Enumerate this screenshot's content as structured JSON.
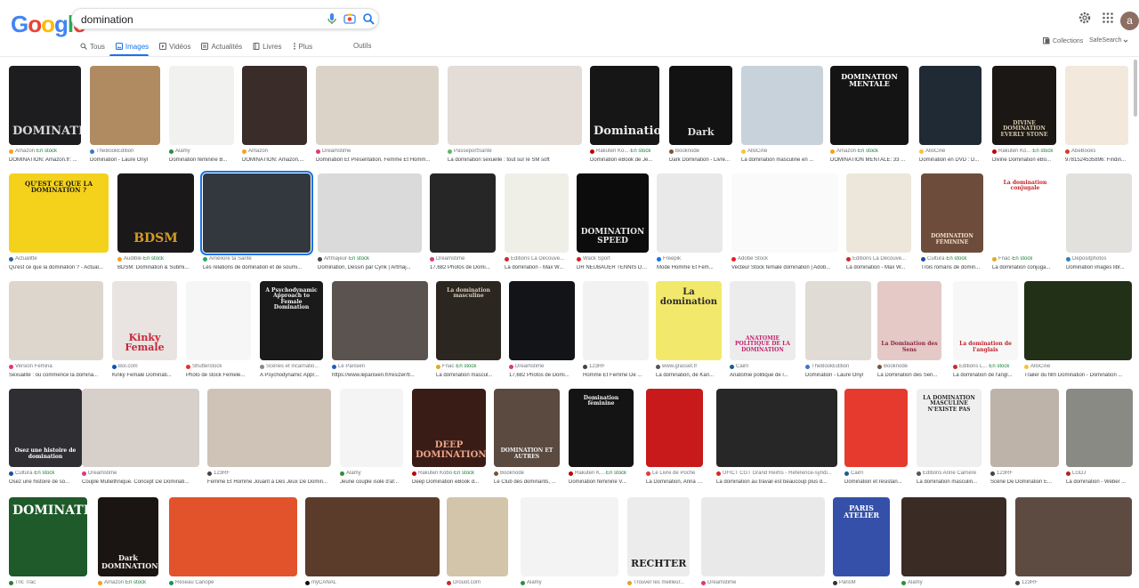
{
  "header": {
    "logo": "Google",
    "query": "domination",
    "colors": {
      "blue": "#4285f4",
      "red": "#ea4335",
      "yellow": "#fbbc05",
      "green": "#34a853",
      "accent": "#1a73e8"
    },
    "avatar_letter": "a",
    "icons": [
      "microphone-icon",
      "camera-icon",
      "search-icon",
      "gear-icon",
      "apps-grid-icon"
    ]
  },
  "tabs": [
    {
      "label": "Tous",
      "icon": "search-icon"
    },
    {
      "label": "Images",
      "icon": "image-icon"
    },
    {
      "label": "Vidéos",
      "icon": "play-icon"
    },
    {
      "label": "Actualités",
      "icon": "news-icon"
    },
    {
      "label": "Livres",
      "icon": "book-icon"
    },
    {
      "label": "Plus",
      "icon": "more-vert-icon"
    }
  ],
  "tools_label": "Outils",
  "collections_label": "Collections",
  "safesearch_label": "SafeSearch",
  "results": [
    [
      {
        "source": "Amazon",
        "stock": "En stock",
        "title": "DOMINATION: Amazon.fr: ...",
        "fav": "#f7a21b",
        "bg": "#1d1d20",
        "text": "DOMINATION",
        "text_color": "#d7d7d7"
      },
      {
        "source": "TheBookEdition",
        "title": "Domination - Laure Onyl",
        "fav": "#3b78c2",
        "bg": "#b08b62"
      },
      {
        "source": "Alamy",
        "title": "Domination féminine B...",
        "fav": "#2f8d3e",
        "bg": "#f1f1ef"
      },
      {
        "source": "Amazon",
        "title": "DOMINATION: Amazon....",
        "fav": "#f7a21b",
        "bg": "#3a2c29"
      },
      {
        "source": "Dreamstime",
        "title": "Domination Et Présentation. Femme Et Homm...",
        "fav": "#d93a7a",
        "bg": "#dcd3c8"
      },
      {
        "source": "PasseportSanté",
        "title": "La domination sexuelle : tout sur le SM soft",
        "fav": "#62b56a",
        "bg": "#e3dcd7"
      },
      {
        "source": "Rakuten Ko...",
        "stock": "En stock",
        "title": "Domination eBook de Je...",
        "fav": "#bf0000",
        "bg": "#161616",
        "text": "Domination",
        "text_color": "#e9e9e9"
      },
      {
        "source": "Booknode",
        "title": "Dark Domination - Livre...",
        "fav": "#7a5539",
        "bg": "#121212",
        "text": "Dark",
        "text_color": "#ddd"
      },
      {
        "source": "AlloCiné",
        "title": "La domination masculine en ...",
        "fav": "#f6c33a",
        "bg": "#c8d2da"
      },
      {
        "source": "Amazon",
        "stock": "En stock",
        "title": "DOMINATION MENTALE: 33 ...",
        "fav": "#f7a21b",
        "bg": "#141414",
        "text": "DOMINATION MENTALE",
        "text_color": "#fff",
        "text_top": true
      },
      {
        "source": "AlloCiné",
        "title": "Domination en DVD : D...",
        "fav": "#f6c33a",
        "bg": "#202a35"
      },
      {
        "source": "Rakuten Ko...",
        "stock": "En stock",
        "title": "Divine Domination eBo...",
        "fav": "#bf0000",
        "bg": "#1a1714",
        "text": "DIVINE DOMINATION EVERLY STONE",
        "text_color": "#d7c8a8"
      },
      {
        "source": "AbeBooks",
        "title": "9781524535896: Findin...",
        "fav": "#d43d2a",
        "bg": "#f2e9dc"
      }
    ],
    [
      {
        "source": "Actualitte",
        "title": "Qu'est ce que la domination ? - Actual...",
        "fav": "#305f9c",
        "bg": "#f4d21c",
        "text": "QU'EST CE QUE LA DOMINATION ?",
        "text_color": "#1d1d1d",
        "text_top": true
      },
      {
        "source": "Audible",
        "stock": "En stock",
        "title": "BDSM: Domination & Submi...",
        "fav": "#f79c1c",
        "bg": "#1a1818",
        "text": "BDSM",
        "text_color": "#d49c28"
      },
      {
        "source": "Améliore ta Santé",
        "title": "Les relations de domination et de soumi...",
        "fav": "#2da562",
        "bg": "#33383f",
        "selected": true
      },
      {
        "source": "Artmajeur",
        "stock": "En stock",
        "title": "Domination, Dessin par Cyrik | Artmaj...",
        "fav": "#444444",
        "bg": "#dadada"
      },
      {
        "source": "Dreamstime",
        "title": "17,682 Photos de Domi...",
        "fav": "#d93a7a",
        "bg": "#262626"
      },
      {
        "source": "Éditions La Découve...",
        "title": "La domination - Max W...",
        "fav": "#c92c2c",
        "bg": "#efefe7"
      },
      {
        "source": "Wack Sport",
        "title": "DR NEUBAUER TENNIS DE...",
        "fav": "#d82121",
        "bg": "#0c0c0c",
        "text": "DOMINATION SPEED",
        "text_color": "#e6e6e6"
      },
      {
        "source": "Freepik",
        "title": "Mode Homme Et Fem...",
        "fav": "#1273eb",
        "bg": "#e9e9e9"
      },
      {
        "source": "Adobe Stock",
        "title": "Vecteur Stock female domination | Adob...",
        "fav": "#ef1c24",
        "bg": "#fafafa"
      },
      {
        "source": "Éditions La Découve...",
        "title": "La domination - Max W...",
        "fav": "#c92c2c",
        "bg": "#ede7db"
      },
      {
        "source": "Cultura",
        "stock": "En stock",
        "title": "Trois romans de domin...",
        "fav": "#1b4e9b",
        "bg": "#6e4c3b",
        "text": "DOMINATION FÉMININE",
        "text_color": "#f0e1c8"
      },
      {
        "source": "Fnac",
        "stock": "En stock",
        "title": "La domination conjuga...",
        "fav": "#e1a925",
        "bg": "#ffffff",
        "text": "La domination conjugale",
        "text_color": "#c4232a",
        "text_top": true
      },
      {
        "source": "Depositphotos",
        "title": "Domination images libr...",
        "fav": "#2c7fc2",
        "bg": "#e3e1dd"
      }
    ],
    [
      {
        "source": "Version Femina",
        "title": "Sexualité : où commence la domina...",
        "fav": "#e8356d",
        "bg": "#ddd6cd"
      },
      {
        "source": "Bol.com",
        "title": "Kinky Female Dominati...",
        "fav": "#0a55b7",
        "bg": "#e9e3e1",
        "text": "Kinky Female",
        "text_color": "#c6283a"
      },
      {
        "source": "Shutterstock",
        "title": "Photo de stock Femele...",
        "fav": "#ec2e2f",
        "bg": "#f6f6f6"
      },
      {
        "source": "Scènes et incarnatio...",
        "title": "A Psychodynamic Appr...",
        "fav": "#888888",
        "bg": "#1a1a1a",
        "text": "A Psychodynamic Approach to Female Domination",
        "text_color": "#f2f2f2",
        "text_top": true
      },
      {
        "source": "Le Parisien",
        "title": "https://www.leparisien.fr/resizer/tl...",
        "fav": "#1c5fc7",
        "bg": "#5a5350"
      },
      {
        "source": "Fnac",
        "stock": "En stock",
        "title": "La domination mascul...",
        "fav": "#e1a925",
        "bg": "#2c2621",
        "text": "La domination masculine",
        "text_color": "#d8ccb8",
        "text_top": true
      },
      {
        "source": "Dreamstime",
        "title": "17,682 Photos de Domi...",
        "fav": "#d93a7a",
        "bg": "#121418"
      },
      {
        "source": "123RF",
        "title": "Homme Et Femme De ...",
        "fav": "#444444",
        "bg": "#f2f2f2"
      },
      {
        "source": "www.grasset.fr",
        "title": "La domination, de Kari...",
        "fav": "#555555",
        "bg": "#f2e96c",
        "text": "La domination",
        "text_color": "#2a2a2a",
        "text_top": true
      },
      {
        "source": "Cairn",
        "title": "Anatomie politique de l...",
        "fav": "#1a5c8f",
        "bg": "#ececec",
        "text": "ANATOMIE POLITIQUE DE LA DOMINATION",
        "text_color": "#c3206c"
      },
      {
        "source": "TheBookEdition",
        "title": "Domination - Laure Onyl",
        "fav": "#3b78c2",
        "bg": "#e0dbd4"
      },
      {
        "source": "Booknode",
        "title": "La Domination des Sen...",
        "fav": "#7a5539",
        "bg": "#e4c9c6",
        "text": "La Domination des Sens",
        "text_color": "#8d2440"
      },
      {
        "source": "Éditions L...",
        "stock": "En stock",
        "title": "La domination de l'angl...",
        "fav": "#c92c2c",
        "bg": "#f7f7f7",
        "text": "La domination de l'anglais",
        "text_color": "#c0202a"
      },
      {
        "source": "AlloCiné",
        "title": "Trailer du film Domination - Domination ...",
        "fav": "#f6c33a",
        "bg": "#233018"
      }
    ],
    [
      {
        "source": "Cultura",
        "stock": "En stock",
        "title": "Osez une histoire de so...",
        "fav": "#1b4e9b",
        "bg": "#2f2f33",
        "text": "Osez une histoire de domination",
        "text_color": "#ffffff"
      },
      {
        "source": "Dreamstime",
        "title": "Couple Mutiethnique. Concept De Dominati...",
        "fav": "#d93a7a",
        "bg": "#d7cfc9"
      },
      {
        "source": "123RF",
        "title": "Femme Et Homme Jouant à Des Jeux De Domin...",
        "fav": "#444444",
        "bg": "#cfc2b7"
      },
      {
        "source": "Alamy",
        "title": "Jeune couple isolé d'af...",
        "fav": "#2f8d3e",
        "bg": "#f4f4f4"
      },
      {
        "source": "Rakuten Kobo",
        "stock": "En stock",
        "title": "Deep Domination eBook d...",
        "fav": "#bf0000",
        "bg": "#3a1c17",
        "text": "DEEP DOMINATION",
        "text_color": "#e8a689"
      },
      {
        "source": "Booknode",
        "title": "Le Club des dominants, ...",
        "fav": "#7a5539",
        "bg": "#5a4a40",
        "text": "DOMINATION ET AUTRES",
        "text_color": "#f4f4f4"
      },
      {
        "source": "Rakuten K...",
        "stock": "En stock",
        "title": "Domination féminine V...",
        "fav": "#bf0000",
        "bg": "#141414",
        "text": "Domination féminine",
        "text_color": "#f0f0f0",
        "text_top": true
      },
      {
        "source": "Le Livre de Poche",
        "title": "La Domination, Anna d...",
        "fav": "#e23a3a",
        "bg": "#c81a1a"
      },
      {
        "source": "UFICT CGT Grand Reims - Reference-syndi...",
        "title": "La domination au travail est beaucoup plus d...",
        "fav": "#d42a2a",
        "bg": "#272727"
      },
      {
        "source": "Cairn",
        "title": "Domination et résistan...",
        "fav": "#1a5c8f",
        "bg": "#e63a2f"
      },
      {
        "source": "Éditions Anne Carrière",
        "title": "La domination masculin...",
        "fav": "#555555",
        "bg": "#efefef",
        "text": "LA DOMINATION MASCULINE N'EXISTE PAS",
        "text_color": "#2a2a2a",
        "text_top": true
      },
      {
        "source": "123RF",
        "title": "Scène De Domination E...",
        "fav": "#444444",
        "bg": "#bdb3a8"
      },
      {
        "source": "LGDJ",
        "title": "La domination - Weber ...",
        "fav": "#b32424",
        "bg": "#8a8a85"
      }
    ],
    [
      {
        "source": "Tric Trac",
        "title": "",
        "fav": "#2b7a3a",
        "bg": "#1f5a2a",
        "text": "DOMINATION",
        "text_color": "#ffffff",
        "text_top": true
      },
      {
        "source": "Amazon",
        "stock": "En stock",
        "title": "",
        "fav": "#f7a21b",
        "bg": "#1a1413",
        "text": "Dark DOMINATION",
        "text_color": "#f2f2f2"
      },
      {
        "source": "Réseau Canopé",
        "title": "",
        "fav": "#1d8f5a",
        "bg": "#e2532c"
      },
      {
        "source": "myCANAL",
        "title": "",
        "fav": "#111111",
        "bg": "#5b3b2a"
      },
      {
        "source": "Drouot.com",
        "title": "",
        "fav": "#c42d2d",
        "bg": "#d2c5aa"
      },
      {
        "source": "Alamy",
        "title": "",
        "fav": "#2f8d3e",
        "bg": "#f3f3f3"
      },
      {
        "source": "Trouver les meilleur...",
        "title": "",
        "fav": "#e6a02a",
        "bg": "#ececec",
        "text": "RECHTER",
        "text_color": "#202020"
      },
      {
        "source": "Dreamstime",
        "title": "",
        "fav": "#d93a7a",
        "bg": "#e9e9e9"
      },
      {
        "source": "ParisM",
        "title": "",
        "fav": "#333333",
        "bg": "#3550a8",
        "text": "PARIS ATELIER",
        "text_color": "#ffffff",
        "text_top": true
      },
      {
        "source": "Alamy",
        "title": "",
        "fav": "#2f8d3e",
        "bg": "#3b2b25"
      },
      {
        "source": "123RF",
        "title": "",
        "fav": "#444444",
        "bg": "#5d4a40"
      }
    ]
  ]
}
